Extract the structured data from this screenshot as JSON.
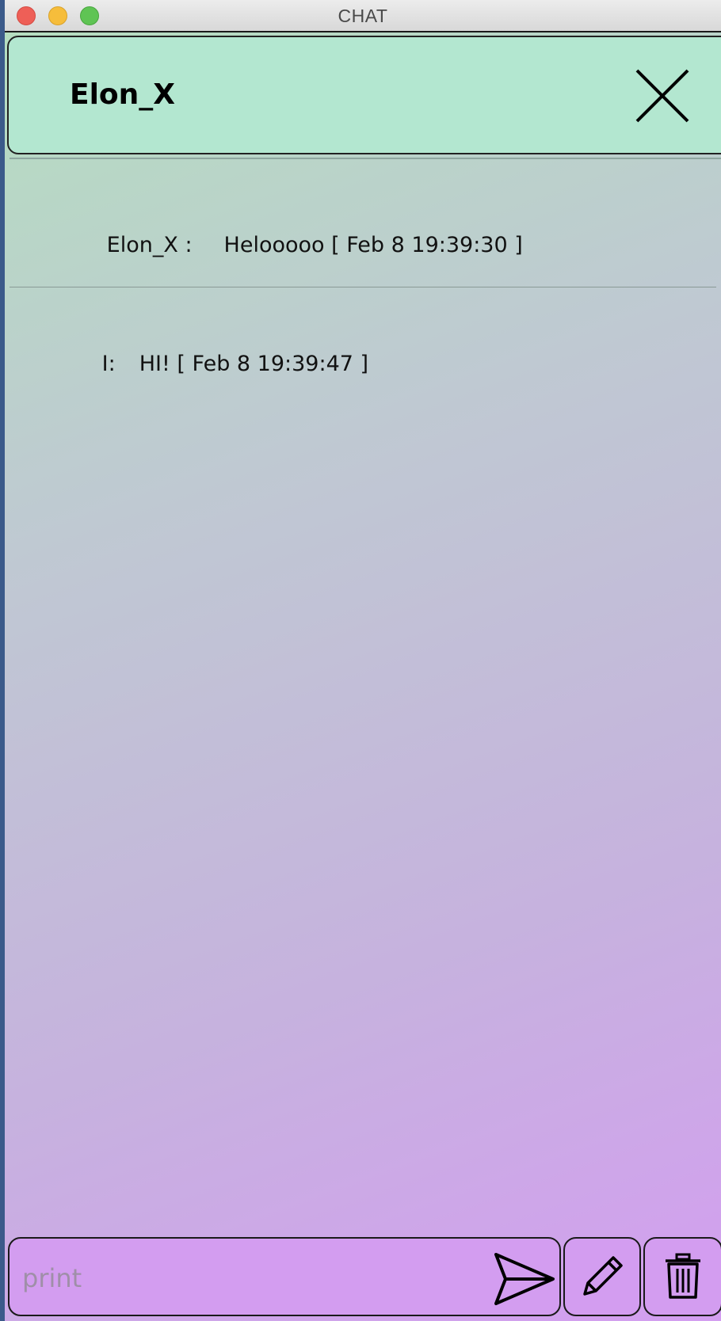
{
  "window": {
    "title": "CHAT"
  },
  "header": {
    "contact_name": "Elon_X",
    "close_icon": "close-x-icon"
  },
  "messages": [
    {
      "sender": "Elon_X :",
      "text": "Helooooo [ Feb 8 19:39:30 ]"
    },
    {
      "sender": "I:",
      "text": "HI! [ Feb 8 19:39:47 ]"
    }
  ],
  "composer": {
    "placeholder": "print",
    "value": "",
    "send_icon": "send-icon",
    "edit_icon": "pencil-icon",
    "delete_icon": "trash-icon"
  },
  "colors": {
    "header_bg": "#b3e7d0",
    "gradient_top": "#b4dfbf",
    "gradient_bottom": "#d39ef0"
  }
}
